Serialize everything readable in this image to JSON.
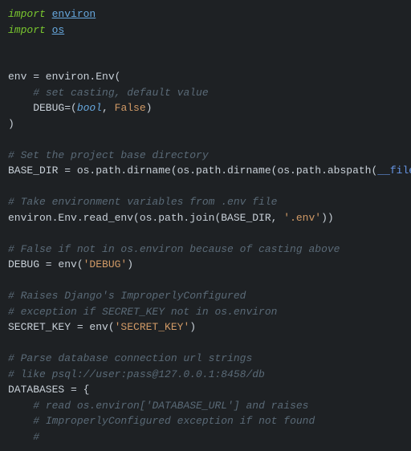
{
  "code": {
    "l1": {
      "kw": "import",
      "sp": " ",
      "mod": "environ"
    },
    "l2": {
      "kw": "import",
      "sp": " ",
      "mod": "os"
    },
    "l3": "",
    "l4": "",
    "l5": "env = environ.Env(",
    "l6": {
      "indent": "    ",
      "cm": "# set casting, default value"
    },
    "l7": {
      "a": "    DEBUG=(",
      "b": "bool",
      "c": ", ",
      "d": "False",
      "e": ")"
    },
    "l8": ")",
    "l9": "",
    "l10": {
      "cm": "# Set the project base directory"
    },
    "l11": {
      "a": "BASE_DIR = os.path.dirname(os.path.dirname(os.path.abspath(",
      "b": "__file__",
      "c": ")))"
    },
    "l12": "",
    "l13": {
      "cm": "# Take environment variables from .env file"
    },
    "l14": {
      "a": "environ.Env.read_env(os.path.join(BASE_DIR, ",
      "b": "'.env'",
      "c": "))"
    },
    "l15": "",
    "l16": {
      "cm": "# False if not in os.environ because of casting above"
    },
    "l17": {
      "a": "DEBUG = env(",
      "b": "'DEBUG'",
      "c": ")"
    },
    "l18": "",
    "l19": {
      "cm": "# Raises Django's ImproperlyConfigured"
    },
    "l20": {
      "cm": "# exception if SECRET_KEY not in os.environ"
    },
    "l21": {
      "a": "SECRET_KEY = env(",
      "b": "'SECRET_KEY'",
      "c": ")"
    },
    "l22": "",
    "l23": {
      "cm": "# Parse database connection url strings"
    },
    "l24": {
      "cm": "# like psql://user:pass@127.0.0.1:8458/db"
    },
    "l25": "DATABASES = {",
    "l26": {
      "indent": "    ",
      "cm": "# read os.environ['DATABASE_URL'] and raises"
    },
    "l27": {
      "indent": "    ",
      "cm": "# ImproperlyConfigured exception if not found"
    },
    "l28": {
      "indent": "    ",
      "cm": "#"
    }
  }
}
